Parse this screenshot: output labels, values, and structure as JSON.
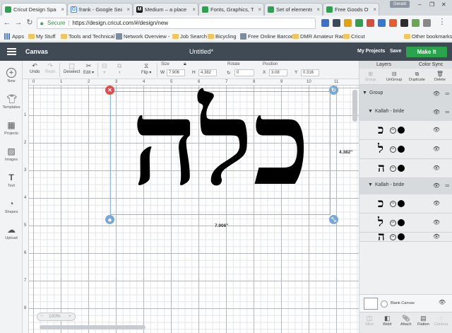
{
  "browser": {
    "tabs": [
      {
        "label": "Cricut Design Space",
        "active": true,
        "favicon_color": "#2aa44c"
      },
      {
        "label": "frank - Google Searc",
        "active": false,
        "favicon_color": "#4285f4"
      },
      {
        "label": "Medium – a place to",
        "active": false,
        "favicon_color": "#111111"
      },
      {
        "label": "Fonts, Graphics, The",
        "active": false,
        "favicon_color": "#2aa44c"
      },
      {
        "label": "Set of elements for",
        "active": false,
        "favicon_color": "#2aa44c"
      },
      {
        "label": "Free Goods Of The",
        "active": false,
        "favicon_color": "#2aa44c"
      }
    ],
    "profile": "Gerald",
    "address": {
      "secure_label": "Secure",
      "url": "https://design.cricut.com/#/design/new"
    },
    "bookmarks": [
      {
        "label": "Apps",
        "icon": "apps-grid-icon"
      },
      {
        "label": "My Stuff",
        "icon": "folder-icon"
      },
      {
        "label": "Tools and Technical S",
        "icon": "folder-icon"
      },
      {
        "label": "Network Overview -",
        "icon": "generic-page-icon"
      },
      {
        "label": "Job Search",
        "icon": "folder-icon"
      },
      {
        "label": "Bicycling",
        "icon": "folder-icon"
      },
      {
        "label": "Free Online Barcode",
        "icon": "generic-page-icon"
      },
      {
        "label": "DMR Amateur Radio",
        "icon": "folder-icon"
      },
      {
        "label": "Cricut",
        "icon": "folder-icon"
      }
    ],
    "other_bookmarks": "Other bookmarks"
  },
  "header": {
    "section": "Canvas",
    "document_title": "Untitled*",
    "my_projects": "My Projects",
    "save": "Save",
    "make_it": "Make It"
  },
  "toolbar": {
    "undo": "Undo",
    "redo": "Redo",
    "deselect": "Deselect",
    "edit": "Edit",
    "flip": "Flip",
    "size_label": "Size",
    "size_w": "7.906",
    "size_h": "4.382",
    "rotate_label": "Rotate",
    "rotate_value": "0",
    "position_label": "Position",
    "pos_x": "3.08",
    "pos_y": "0.316"
  },
  "sidebar": {
    "items": [
      {
        "label": "New",
        "icon": "plus-icon"
      },
      {
        "label": "Templates",
        "icon": "shirt-icon"
      },
      {
        "label": "Projects",
        "icon": "grid-icon"
      },
      {
        "label": "Images",
        "icon": "image-icon"
      },
      {
        "label": "Text",
        "icon": "text-icon"
      },
      {
        "label": "Shapes",
        "icon": "shapes-icon"
      },
      {
        "label": "Upload",
        "icon": "upload-icon"
      }
    ]
  },
  "canvas": {
    "ruler_top": [
      "0",
      "1",
      "2",
      "3",
      "4",
      "5",
      "6",
      "7",
      "8",
      "9",
      "10",
      "11"
    ],
    "ruler_left": [
      "1",
      "2",
      "3",
      "4",
      "5",
      "6",
      "7",
      "8"
    ],
    "hebrew_text": "כלה",
    "width_readout": "7.906\"",
    "height_readout": "4.382\"",
    "zoom": "100%"
  },
  "layers": {
    "tabs": [
      "Layers",
      "Color Sync"
    ],
    "actions": [
      "Group",
      "UnGroup",
      "Duplicate",
      "Delete"
    ],
    "group_label": "Group",
    "subgroups": [
      {
        "label": "Kallah - bride",
        "glyphs": [
          "כ",
          "ל",
          "ה"
        ]
      },
      {
        "label": "Kallah - bride",
        "glyphs": [
          "כ",
          "ל",
          "ה"
        ]
      }
    ],
    "blank_canvas": "Blank Canvas",
    "bottom_actions": [
      "Slice",
      "Weld",
      "Attach",
      "Flatten",
      "Contour"
    ]
  }
}
